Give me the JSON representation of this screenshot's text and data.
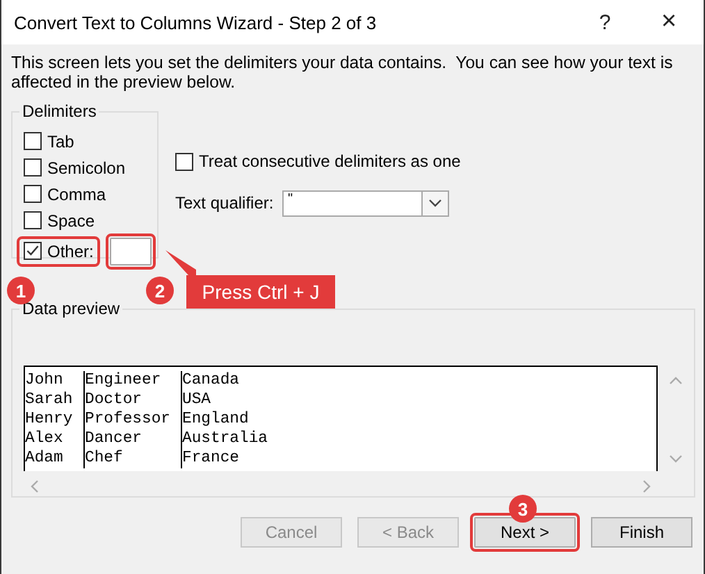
{
  "window": {
    "title": "Convert Text to Columns Wizard - Step 2 of 3",
    "help": "?",
    "close": "×"
  },
  "intro": "This screen lets you set the delimiters your data contains.  You can see how your text is affected in the preview below.",
  "delimiters": {
    "title": "Delimiters",
    "items": [
      {
        "label": "Tab",
        "checked": false,
        "highlighted": false
      },
      {
        "label": "Semicolon",
        "checked": false,
        "highlighted": false
      },
      {
        "label": "Comma",
        "checked": false,
        "highlighted": false
      },
      {
        "label": "Space",
        "checked": false,
        "highlighted": false
      },
      {
        "label": "Other:",
        "checked": true,
        "highlighted": true
      }
    ],
    "other_field": {
      "highlighted": true
    }
  },
  "consecutive": {
    "label": "Treat consecutive delimiters as one",
    "checked": false
  },
  "text_qualifier": {
    "label": "Text qualifier:",
    "value": "\""
  },
  "preview": {
    "title": "Data preview",
    "rows": [
      [
        "John",
        "Engineer",
        "Canada"
      ],
      [
        "Sarah",
        "Doctor",
        "USA"
      ],
      [
        "Henry",
        "Professor",
        "England"
      ],
      [
        "Alex",
        "Dancer",
        "Australia"
      ],
      [
        "Adam",
        "Chef",
        "France"
      ]
    ]
  },
  "buttons": [
    {
      "label": "Cancel",
      "disabled": true,
      "highlighted": false
    },
    {
      "label": "< Back",
      "disabled": true,
      "highlighted": false
    },
    {
      "label": "Next >",
      "disabled": false,
      "highlighted": true
    },
    {
      "label": "Finish",
      "disabled": false,
      "highlighted": false
    }
  ],
  "annotations": [
    {
      "number": "1"
    },
    {
      "number": "2",
      "callout": "Press Ctrl + J"
    },
    {
      "number": "3"
    }
  ]
}
